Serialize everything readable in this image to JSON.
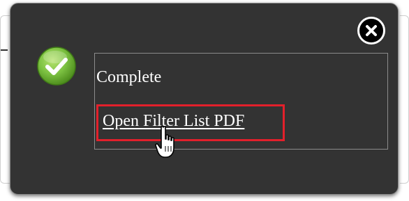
{
  "dialog": {
    "status_text": "Complete",
    "link_text": "Open Filter List PDF",
    "close_icon": "close-icon",
    "status_icon": "check-circle-icon",
    "cursor_icon": "hand-pointer-icon"
  },
  "colors": {
    "dialog_bg": "#333333",
    "check_green": "#7dc242",
    "highlight_red": "#e3202b",
    "text": "#ffffff"
  }
}
